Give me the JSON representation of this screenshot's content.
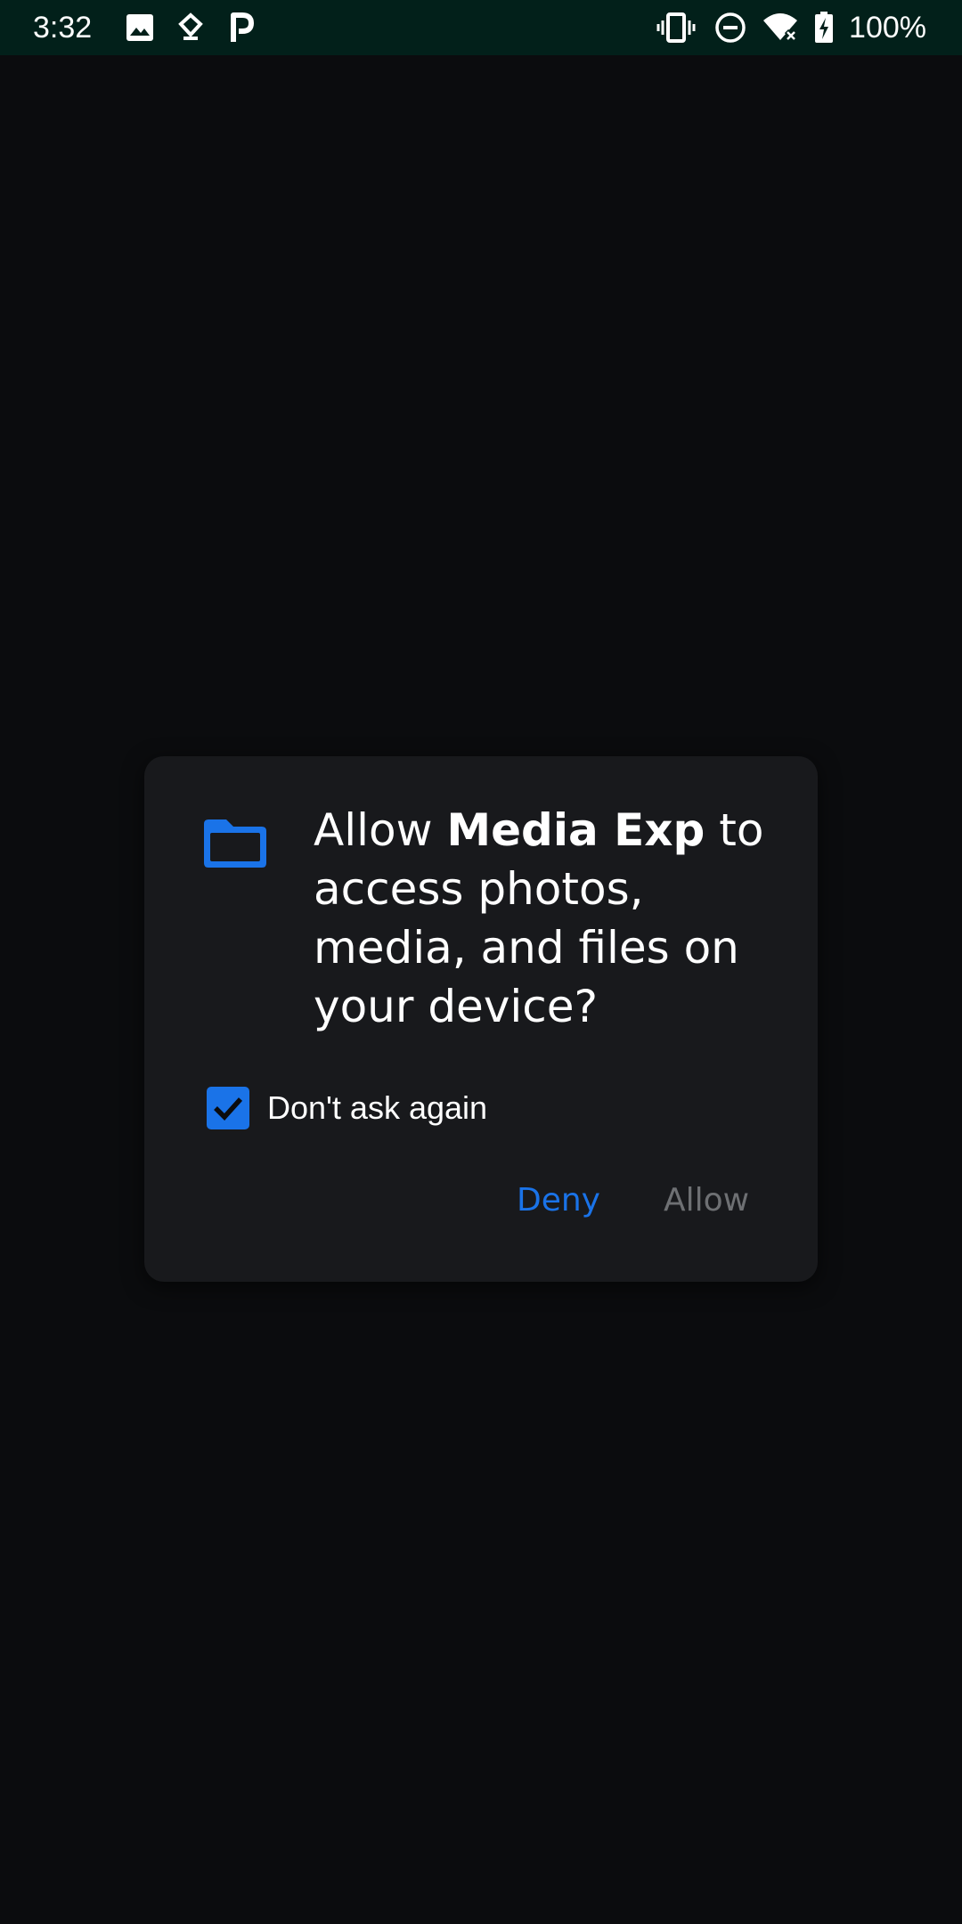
{
  "status_bar": {
    "time": "3:32",
    "battery": "100%",
    "left_icons": [
      "image-icon",
      "location-heart-icon",
      "parking-icon"
    ],
    "right_icons": [
      "vibrate-icon",
      "do-not-disturb-icon",
      "wifi-off-icon",
      "battery-charging-icon"
    ]
  },
  "dialog": {
    "icon": "folder-icon",
    "title_prefix": "Allow ",
    "app_name": "Media Exp",
    "title_suffix": " to access photos, media, and files on your device?",
    "checkbox": {
      "label": "Don't ask again",
      "checked": true
    },
    "buttons": {
      "deny": "Deny",
      "allow": "Allow"
    },
    "colors": {
      "accent": "#1a73e8",
      "disabled_text": "#6e7073",
      "dialog_bg": "#18191c",
      "status_bar_bg": "#02201a"
    }
  }
}
